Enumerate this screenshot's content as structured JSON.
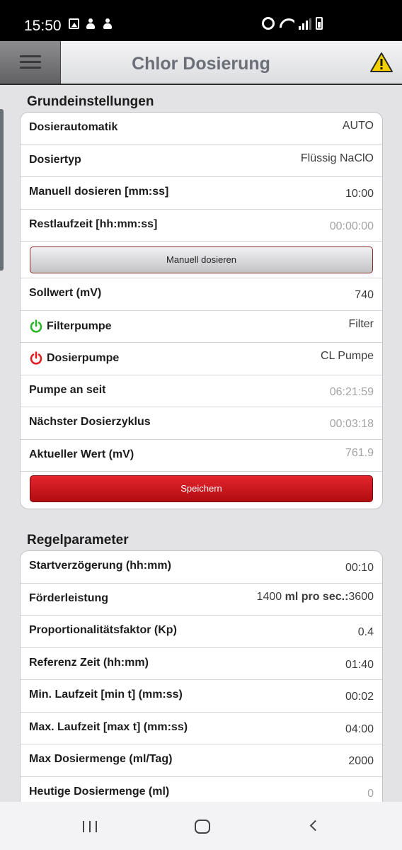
{
  "status_bar": {
    "time": "15:50"
  },
  "header": {
    "title": "Chlor Dosierung"
  },
  "grundeinstellungen": {
    "title": "Grundeinstellungen",
    "rows": [
      {
        "label": "Dosierautomatik",
        "value": "AUTO"
      },
      {
        "label": "Dosiertyp",
        "value": "Flüssig NaClO"
      },
      {
        "label": "Manuell dosieren [mm:ss]",
        "value": "10:00"
      },
      {
        "label": "Restlaufzeit [hh:mm:ss]",
        "value": "00:00:00"
      }
    ],
    "manual_button": "Manuell dosieren",
    "rows2": [
      {
        "label": "Sollwert (mV)",
        "value": "740"
      },
      {
        "label": "Filterpumpe",
        "value": "Filter",
        "icon_color": "#2bb52b"
      },
      {
        "label": "Dosierpumpe",
        "value": "CL Pumpe",
        "icon_color": "#e02020"
      },
      {
        "label": "Pumpe an seit",
        "value": "06:21:59"
      },
      {
        "label": "Nächster Dosierzyklus",
        "value": "00:03:18"
      },
      {
        "label": "Aktueller Wert (mV)",
        "value": "761.9"
      }
    ],
    "save_button": "Speichern"
  },
  "regelparameter": {
    "title": "Regelparameter",
    "rows": [
      {
        "label": "Startverzögerung (hh:mm)",
        "value": "00:10"
      },
      {
        "label": "Förderleistung",
        "value_num": "1400",
        "value_unit": "ml pro sec.:",
        "value_num2": "3600"
      },
      {
        "label": "Proportionalitätsfaktor (Kp)",
        "value": "0.4"
      },
      {
        "label": "Referenz Zeit (hh:mm)",
        "value": "01:40"
      },
      {
        "label": "Min. Laufzeit [min t] (mm:ss)",
        "value": "00:02"
      },
      {
        "label": "Max. Laufzeit [max t] (mm:ss)",
        "value": "04:00"
      },
      {
        "label": "Max Dosiermenge (ml/Tag)",
        "value": "2000"
      },
      {
        "label": "Heutige Dosiermenge (ml)",
        "value": "0"
      }
    ]
  },
  "icons": [
    "menu-icon",
    "warning-icon",
    "power-icon",
    "recent-apps-icon",
    "home-icon",
    "back-icon"
  ],
  "colors": {
    "accent_red": "#c8141b",
    "warning_yellow": "#f5d000"
  }
}
